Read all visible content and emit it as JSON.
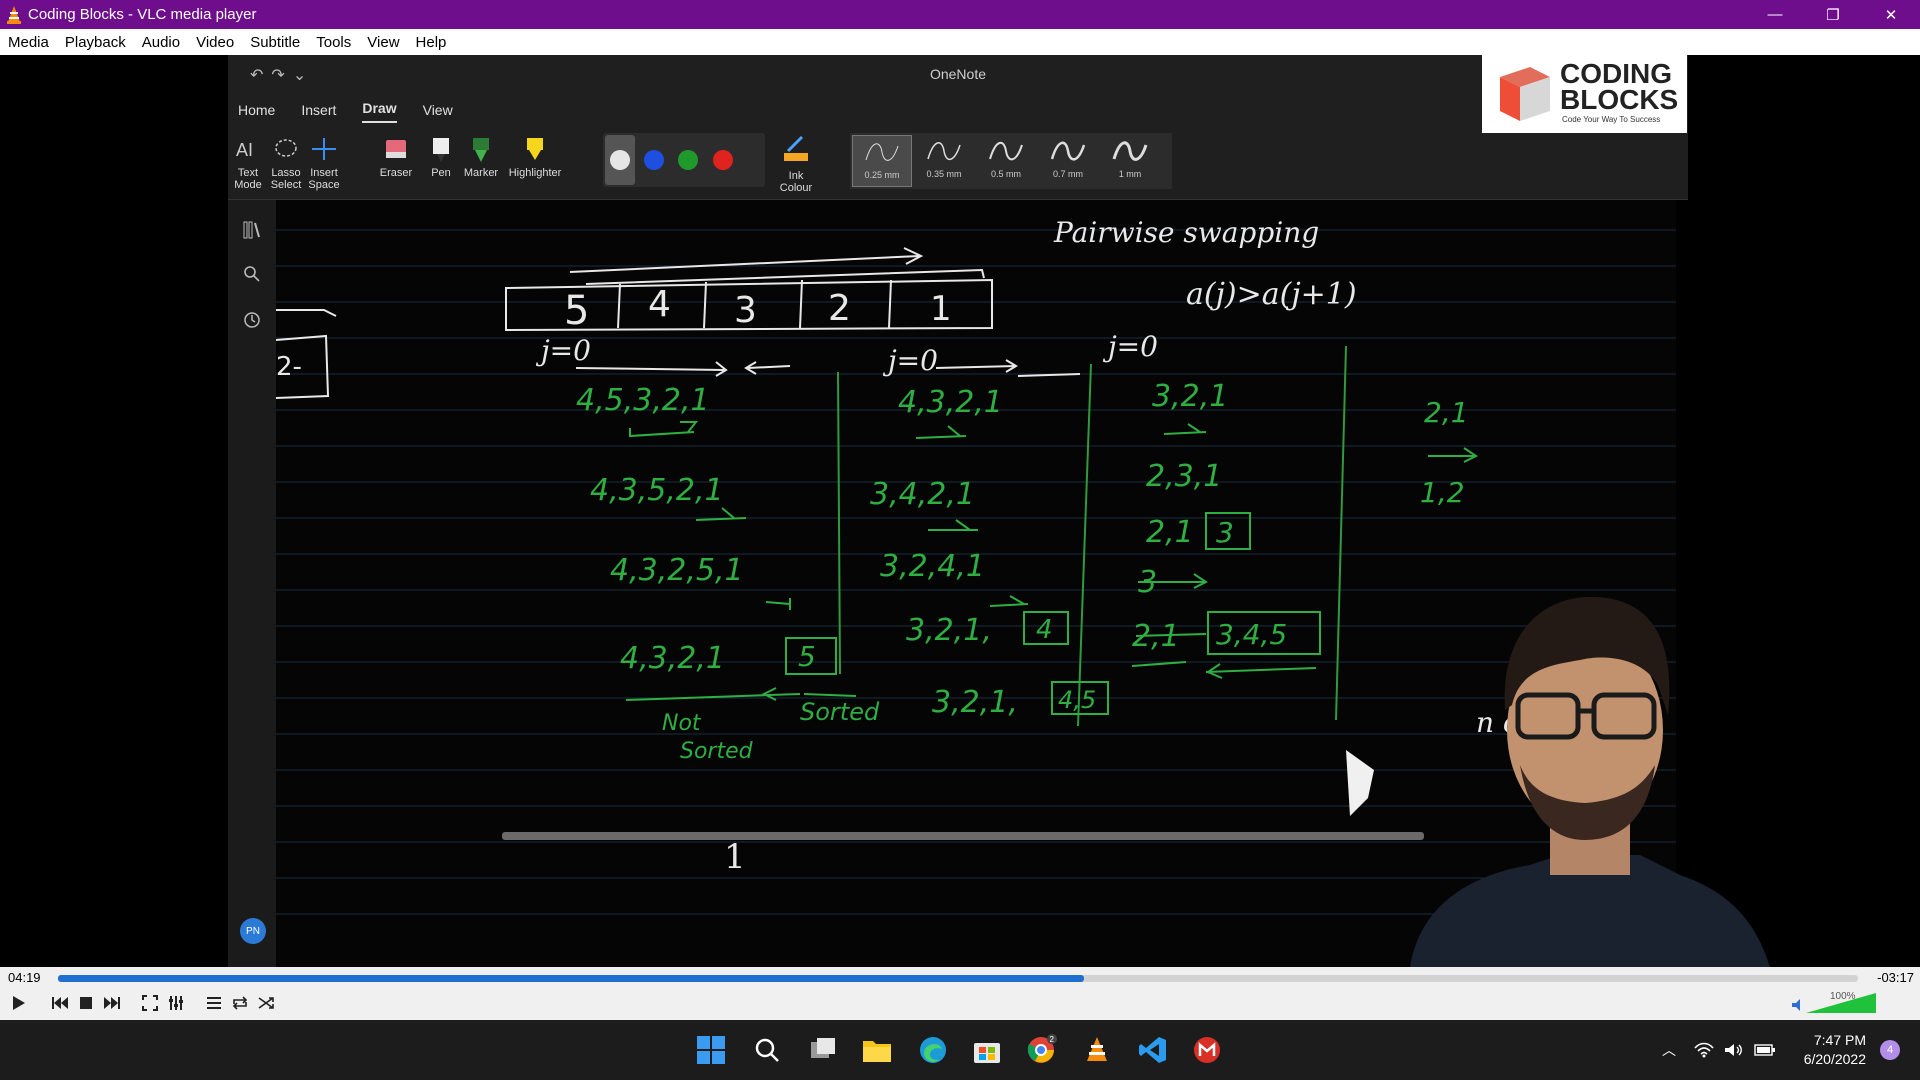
{
  "window": {
    "title": "Coding Blocks - VLC media player"
  },
  "menu": [
    "Media",
    "Playback",
    "Audio",
    "Video",
    "Subtitle",
    "Tools",
    "View",
    "Help"
  ],
  "onenote": {
    "app_title": "OneNote",
    "tabs": [
      "Home",
      "Insert",
      "Draw",
      "View"
    ],
    "active_tab": "Draw",
    "tools": {
      "text_mode": [
        "Text",
        "Mode"
      ],
      "lasso_select": [
        "Lasso",
        "Select"
      ],
      "insert_space": [
        "Insert",
        "Space"
      ],
      "eraser": "Eraser",
      "pen": "Pen",
      "marker": "Marker",
      "highlighter": "Highlighter",
      "ink_colour": [
        "Ink",
        "Colour"
      ]
    },
    "colors": {
      "white": "#e6e6e6",
      "blue": "#1f4fe0",
      "green": "#1f9a2a",
      "red": "#e0231f"
    },
    "thickness": [
      "0.25 mm",
      "0.35 mm",
      "0.5 mm",
      "0.7 mm",
      "1 mm"
    ],
    "selected_thickness": "0.25 mm",
    "avatar_initials": "PN"
  },
  "logo": {
    "line1": "CODING",
    "line2": "BLOCKS",
    "tagline": "Code Your Way To Success"
  },
  "notes": {
    "title": "Pairwise swapping",
    "condition": "a(j)>a(j+1)",
    "array": [
      "5",
      "4",
      "3",
      "2",
      "1"
    ],
    "pass1_label": "j=0",
    "pass1": [
      "4,5,3,2,1",
      "4,3,5,2,1",
      "4,3,2,5,1",
      "4,3,2,1"
    ],
    "pass1_boxed": "5",
    "not_sorted": [
      "Not",
      "Sorted"
    ],
    "sorted": "Sorted",
    "pass2_label": "j=0",
    "pass2": [
      "4,3,2,1",
      "3,4,2,1",
      "3,2,4,1",
      "3,2,1,"
    ],
    "pass2_boxed": "4",
    "pass2_result": "3,2,1,",
    "pass2_result_boxed": "4,5",
    "pass3_label": "j=0",
    "pass3": [
      "3,2,1",
      "2,3,1",
      "2,1",
      "3",
      "2,1"
    ],
    "pass3_boxed_small": "3",
    "pass3_boxed": "3,4,5",
    "pass4": [
      "2,1",
      "1,2"
    ],
    "partial_right": "n cl",
    "digit_one": "1"
  },
  "player": {
    "elapsed": "04:19",
    "remaining": "-03:17",
    "progress": 0.57,
    "volume_label": "100%",
    "volume": 1.0
  },
  "taskbar": {
    "time": "7:47 PM",
    "date": "6/20/2022",
    "notifications": "4",
    "chrome_badge": "2"
  }
}
